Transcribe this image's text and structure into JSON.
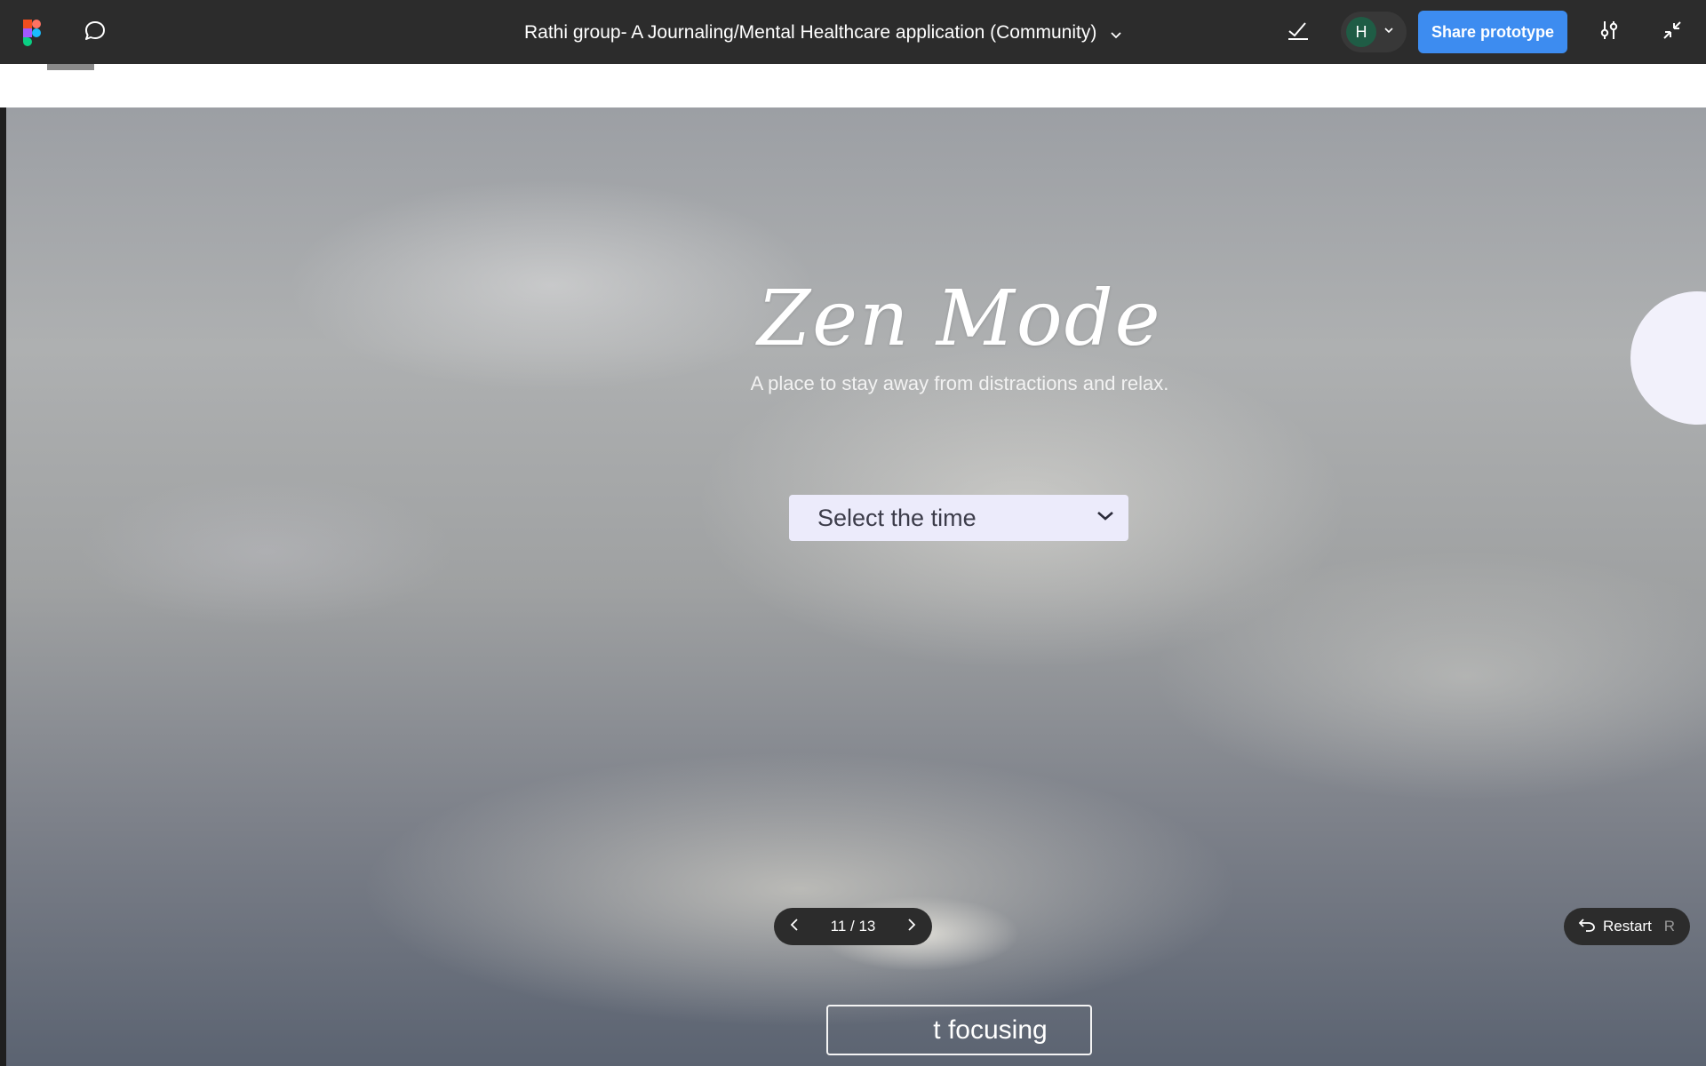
{
  "toolbar": {
    "logo_icon": "figma-logo-icon",
    "comment_icon": "comment-bubble-icon",
    "file_title": "Rathi group- A Journaling/Mental Healthcare application (Community)",
    "title_dropdown_icon": "chevron-down-icon",
    "check_icon": "checkmark-icon",
    "user_initial": "H",
    "user_dropdown_icon": "chevron-down-icon",
    "share_label": "Share prototype",
    "settings_icon": "sliders-icon",
    "collapse_icon": "collapse-arrows-icon",
    "share_color": "#3d8cf0",
    "avatar_color": "#1f5c45"
  },
  "prototype": {
    "title": "Zen Mode",
    "subtitle": "A place to stay away from distractions and relax.",
    "time_select": {
      "label": "Select the time",
      "icon": "chevron-down-icon"
    },
    "focus_button_visible_text": "t focusing",
    "select_bg_color": "#ecebfb"
  },
  "pager": {
    "prev_icon": "chevron-left-icon",
    "count": "11 / 13",
    "next_icon": "chevron-right-icon"
  },
  "restart": {
    "icon": "undo-arrow-icon",
    "label": "Restart",
    "shortcut": "R"
  }
}
